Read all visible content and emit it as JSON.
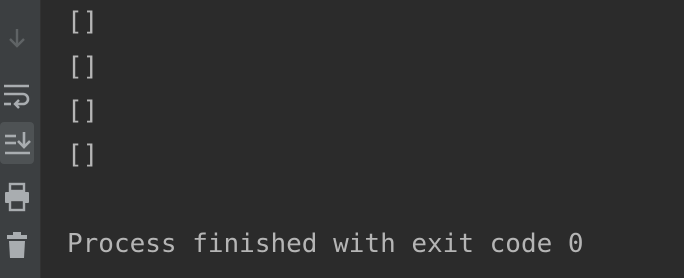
{
  "toolbar": {
    "icons": [
      "arrow-down-icon",
      "soft-wrap-icon",
      "scroll-to-end-icon",
      "print-icon",
      "trash-icon"
    ],
    "active": "scroll-to-end-icon"
  },
  "console": {
    "lines": [
      "[]",
      "[]",
      "[]",
      "[]"
    ],
    "exit_message": "Process finished with exit code 0"
  },
  "colors": {
    "console_bg": "#2b2b2b",
    "toolbar_bg": "#3c3f41",
    "text": "#b5b5b5",
    "icon": "#a9adb0",
    "icon_dim": "#5f6365"
  }
}
